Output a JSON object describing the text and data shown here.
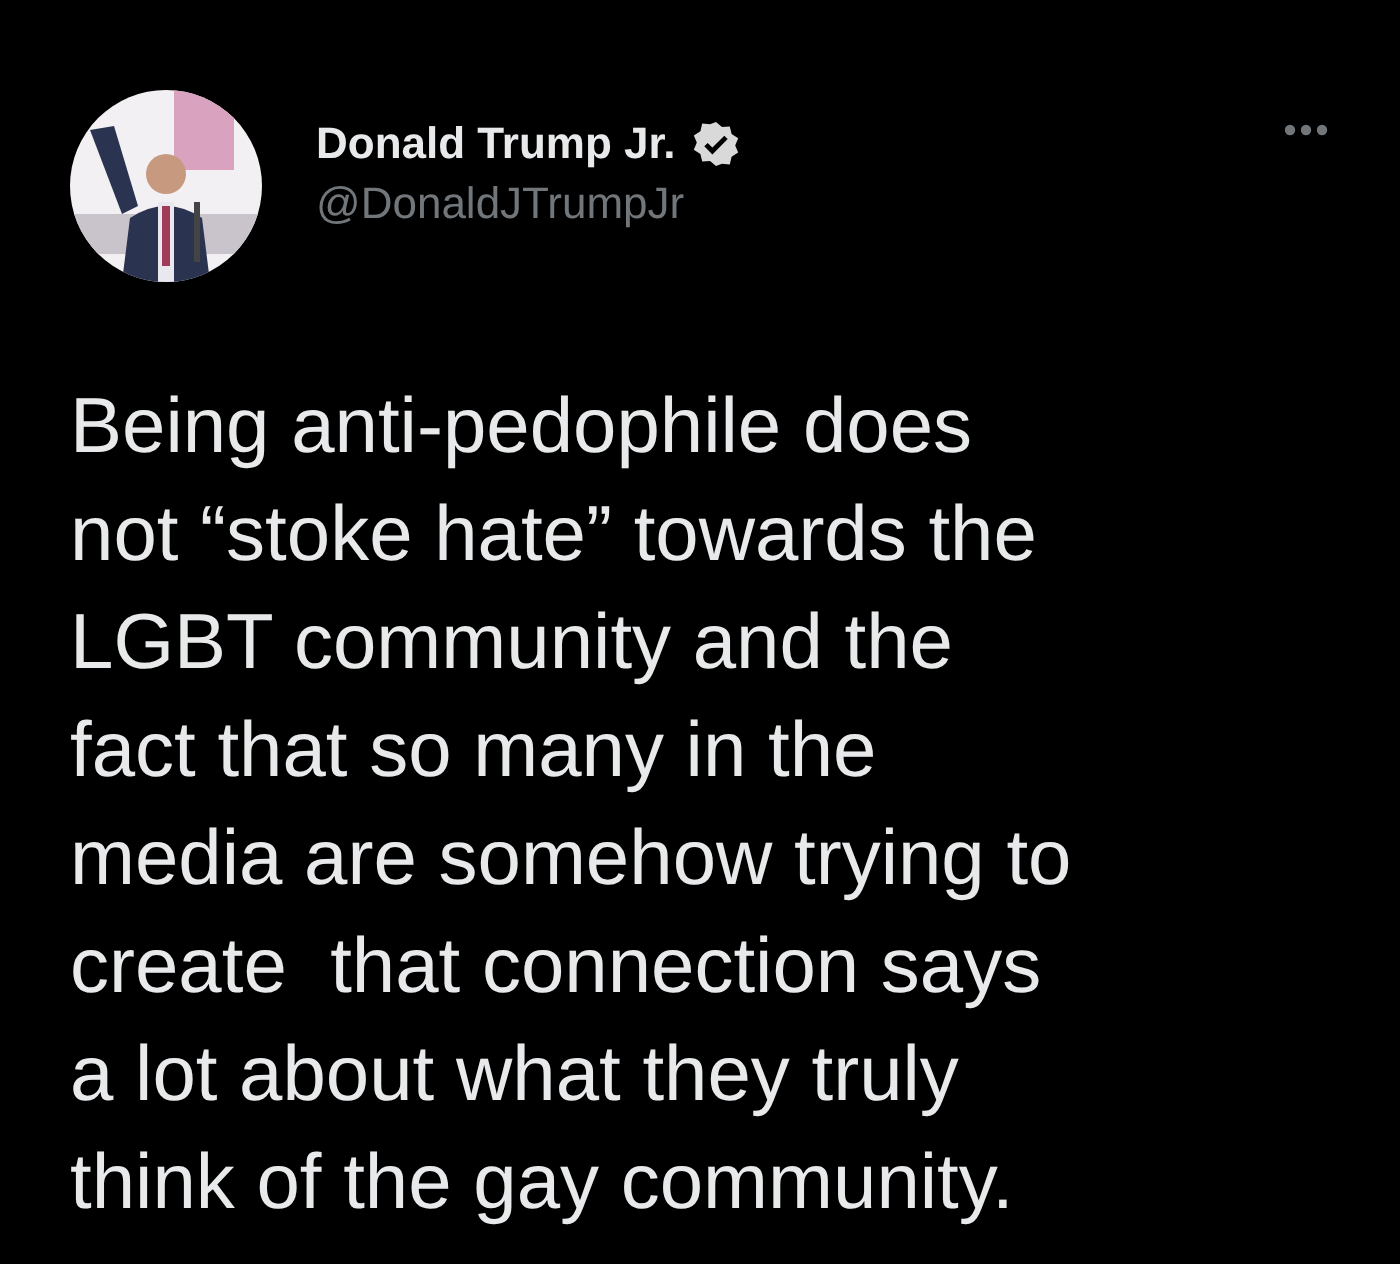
{
  "author": {
    "name": "Donald Trump Jr.",
    "verified": true,
    "handle": "@DonaldJTrumpJr"
  },
  "tweet": {
    "text": "Being anti-pedophile does\nnot “stoke hate” towards the\nLGBT community and the\nfact that so many in the\nmedia are somehow trying to\ncreate  that connection says\na lot about what they truly\nthink of the gay community."
  }
}
